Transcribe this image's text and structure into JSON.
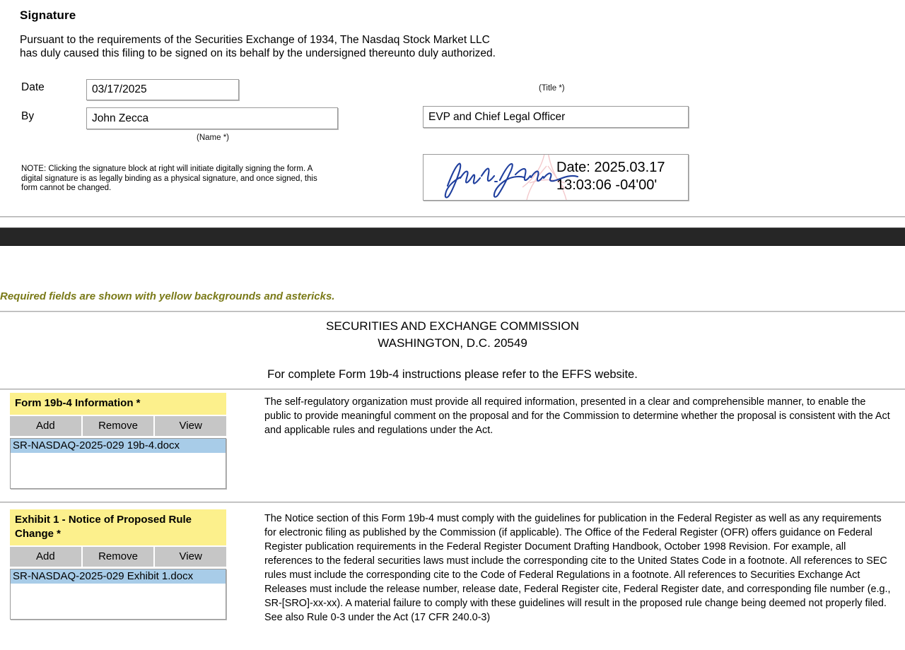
{
  "signature": {
    "heading": "Signature",
    "paragraph": "Pursuant to the requirements of the Securities Exchange of 1934,   The Nasdaq Stock Market LLC\nhas duly caused this filing to be signed on its behalf by the undersigned thereunto duly authorized.",
    "date_label": "Date",
    "by_label": "By",
    "date_value": "03/17/2025",
    "name_value": "John Zecca",
    "title_value": "EVP and Chief Legal Officer",
    "name_caption": "(Name *)",
    "title_caption": "(Title *)",
    "note": "NOTE: Clicking the signature block at right will initiate digitally signing the form. A digital signature is as legally binding as a physical signature, and once signed, this form cannot be changed.",
    "stamp": {
      "signature_name": "John A. Zecca",
      "date_text": "Date: 2025.03.17\n13:03:06 -04'00'",
      "ink_color": "#1f3f9e",
      "watermark_color": "#f3c9cc"
    }
  },
  "effs": {
    "required_note": "Required fields are shown with yellow backgrounds and astericks.",
    "agency": "SECURITIES AND EXCHANGE COMMISSION\nWASHINGTON, D.C. 20549",
    "instructions_line": "For complete Form 19b-4 instructions please refer to the EFFS website.",
    "colors": {
      "required_field": "#fcf08c",
      "button": "#c6c6c6",
      "selected_item": "#a8cce8",
      "required_note_text": "#7a7a18",
      "divider": "#aeaeae",
      "black_bar": "#262626"
    },
    "buttons": {
      "add": "Add",
      "remove": "Remove",
      "view": "View"
    },
    "sections": [
      {
        "title": "Form 19b-4 Information *",
        "files": [
          "SR-NASDAQ-2025-029 19b-4.docx"
        ],
        "description": "The self-regulatory organization must provide all required information, presented in a clear and comprehensible manner, to enable the public to provide meaningful comment on the proposal and for the Commission to determine whether the proposal is consistent with the Act and applicable rules and regulations under the Act."
      },
      {
        "title": "Exhibit 1 - Notice of Proposed Rule Change *",
        "files": [
          "SR-NASDAQ-2025-029 Exhibit 1.docx"
        ],
        "description": "The Notice section of this Form 19b-4 must comply with the guidelines for publication in the Federal Register as well as any requirements for electronic filing as published by the Commission (if applicable).  The Office of the Federal Register (OFR) offers guidance on Federal Register publication requirements in the Federal Register Document Drafting Handbook, October 1998 Revision.  For example, all references to the federal securities laws must include the corresponding cite to the United States Code in a footnote.  All references to SEC rules must include the corresponding cite to the Code of Federal Regulations in a footnote.  All references to Securities Exchange Act Releases must include the release number, release date, Federal Register cite, Federal Register date, and corresponding file number (e.g., SR-[SRO]-xx-xx).  A material failure to comply with these guidelines will result in the proposed rule change being deemed not properly filed.  See also Rule 0-3 under the Act (17 CFR 240.0-3)"
      }
    ]
  }
}
